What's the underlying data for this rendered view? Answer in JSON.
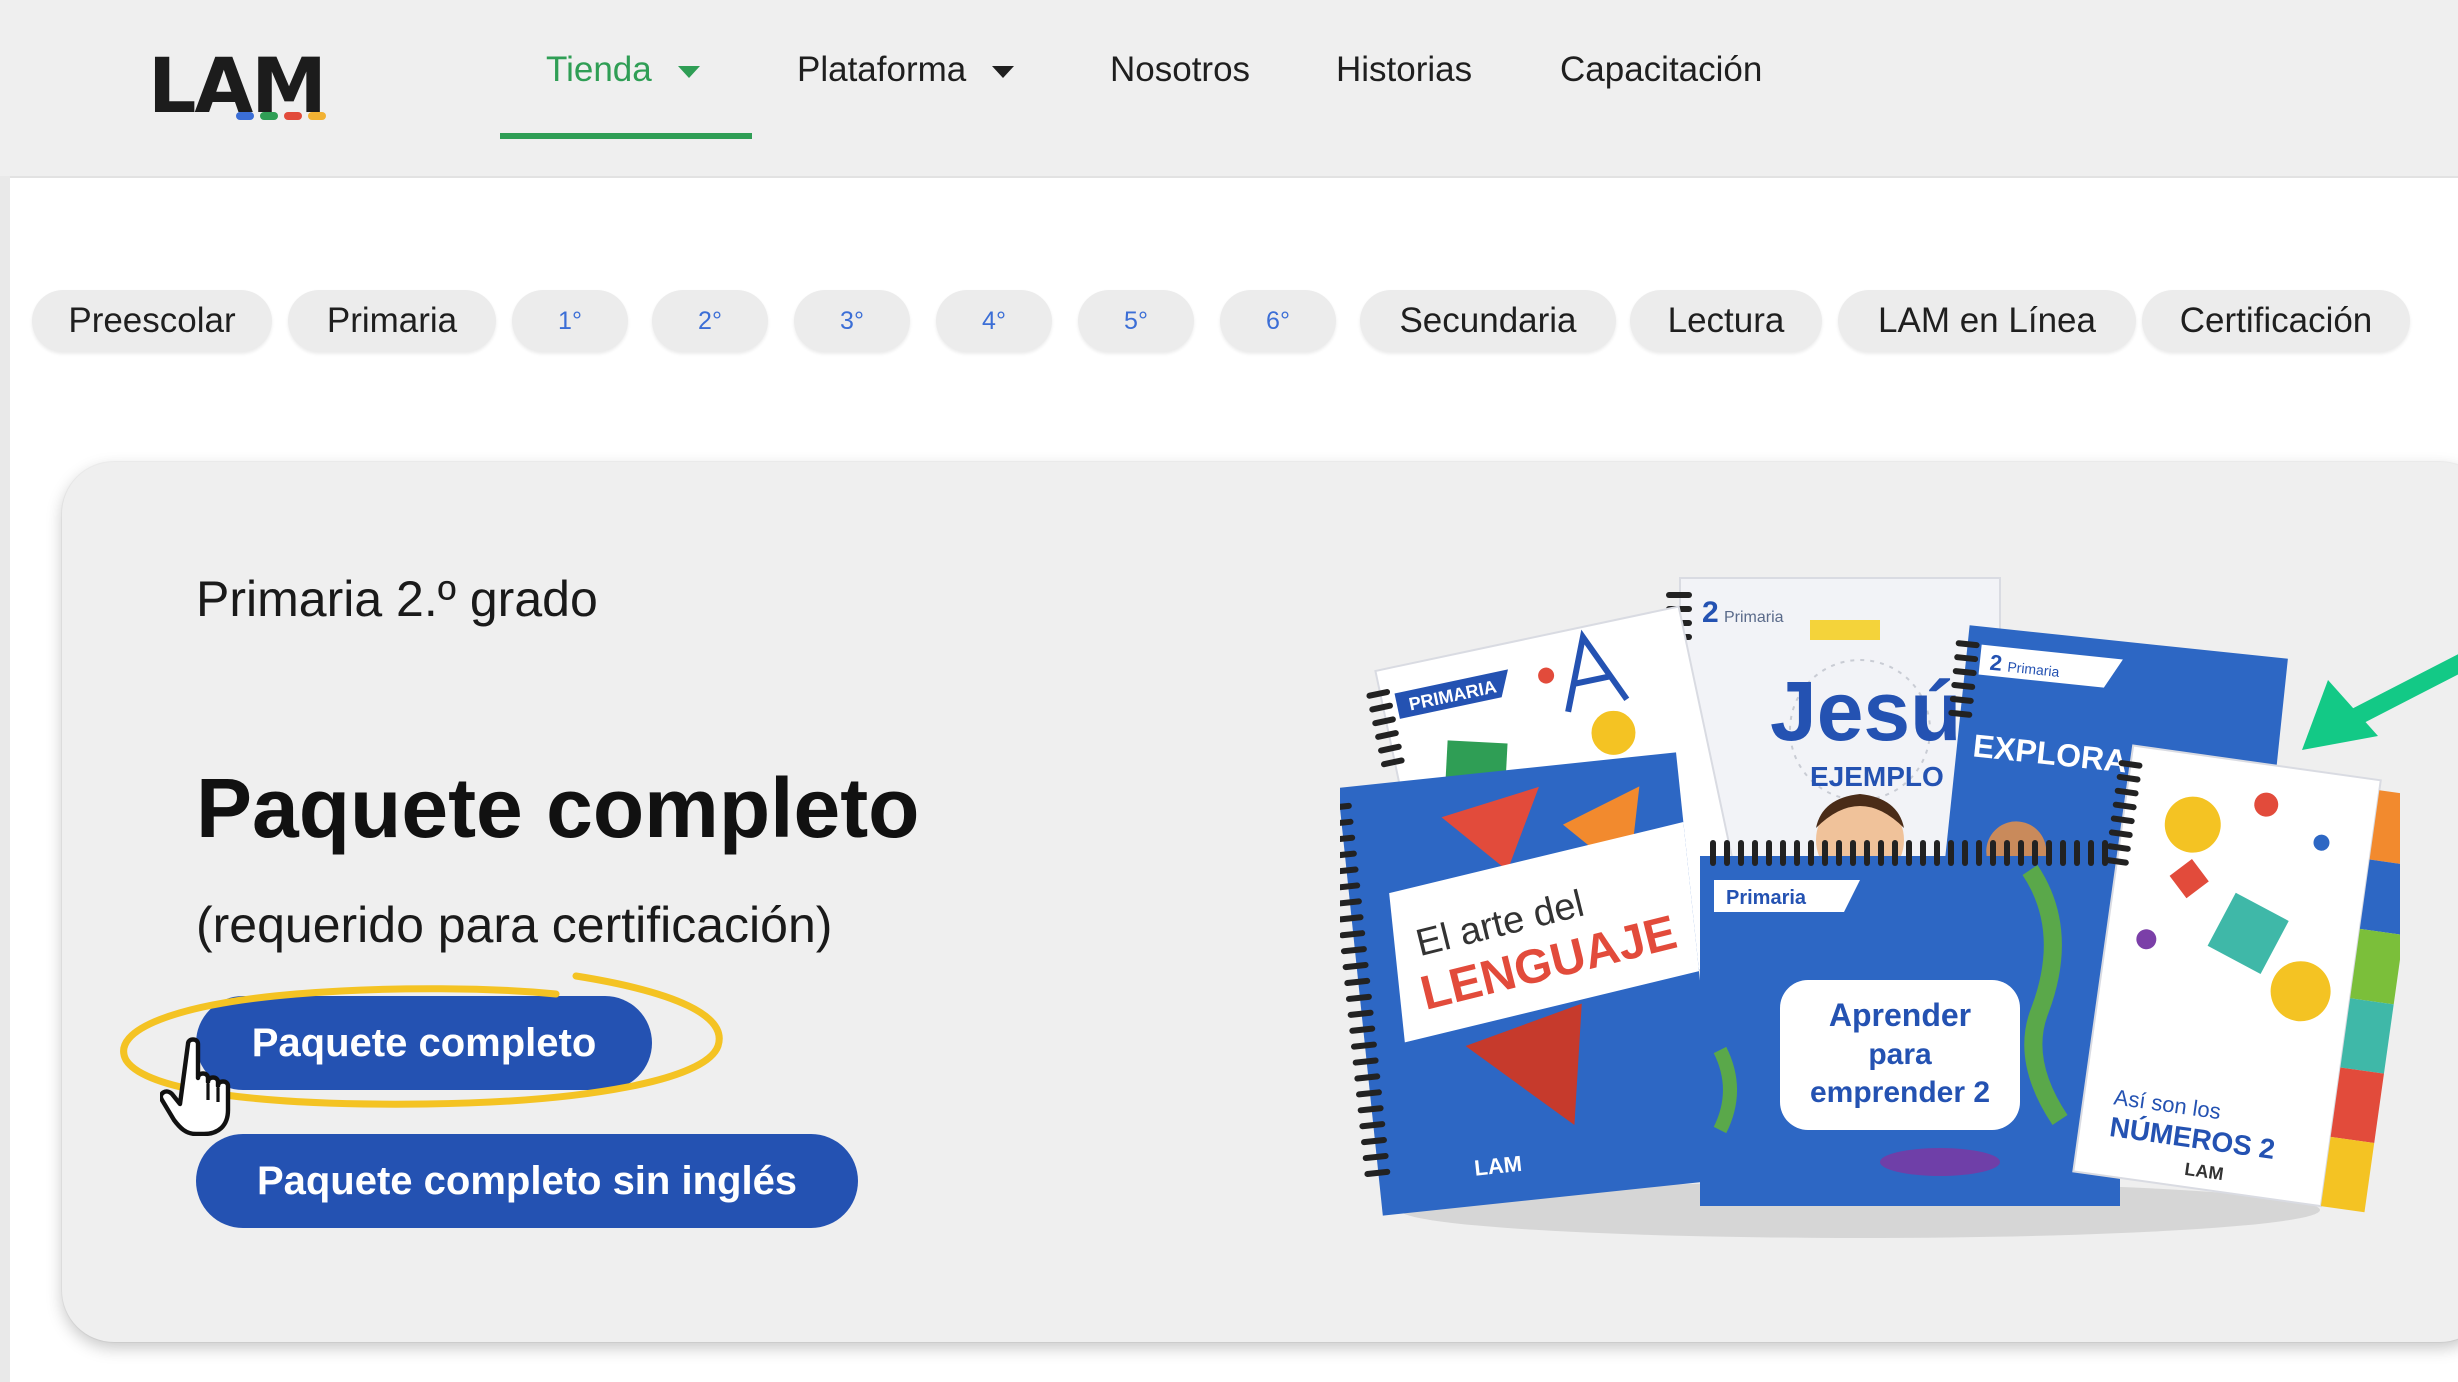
{
  "brand": {
    "logo_text": "LAM",
    "dot_colors": [
      "#3b6ed6",
      "#2f9e55",
      "#e24b3b",
      "#f2b233"
    ]
  },
  "nav": {
    "items": [
      {
        "label": "Tienda",
        "has_caret": true,
        "active": true
      },
      {
        "label": "Plataforma",
        "has_caret": true,
        "active": false
      },
      {
        "label": "Nosotros",
        "has_caret": false,
        "active": false
      },
      {
        "label": "Historias",
        "has_caret": false,
        "active": false
      },
      {
        "label": "Capacitación",
        "has_caret": false,
        "active": false
      }
    ],
    "active_color": "#2f9e55"
  },
  "filters": [
    {
      "label": "Preescolar"
    },
    {
      "label": "Primaria"
    },
    {
      "label": "1°"
    },
    {
      "label": "2°"
    },
    {
      "label": "3°"
    },
    {
      "label": "4°"
    },
    {
      "label": "5°"
    },
    {
      "label": "6°"
    },
    {
      "label": "Secundaria"
    },
    {
      "label": "Lectura"
    },
    {
      "label": "LAM en Línea"
    },
    {
      "label": "Certificación"
    }
  ],
  "product": {
    "grade_title": "Primaria 2.º grado",
    "title": "Paquete completo",
    "subtitle": "(requerido para certificación)",
    "buttons": {
      "full": "Paquete completo",
      "no_english": "Paquete completo sin inglés"
    },
    "button_color": "#2452b2"
  },
  "books": {
    "primaria_label": "PRIMARIA",
    "grade_badge": "2",
    "grade_small": "Primaria",
    "jesus_title": "Jesús",
    "jesus_subtitle": "EJEMPLO",
    "explora": "EXPLORA",
    "arte_line1": "El arte del",
    "arte_line2": "LENGUAJE",
    "aprender_tab": "Primaria",
    "aprender_line1": "Aprender",
    "aprender_line2": "para",
    "aprender_line3": "emprender 2",
    "numeros_line1": "Así son los",
    "numeros_line2": "NÚMEROS 2",
    "publisher": "LAM"
  },
  "annotations": {
    "highlight_color": "#f4c323",
    "arrow_color": "#13c986"
  }
}
